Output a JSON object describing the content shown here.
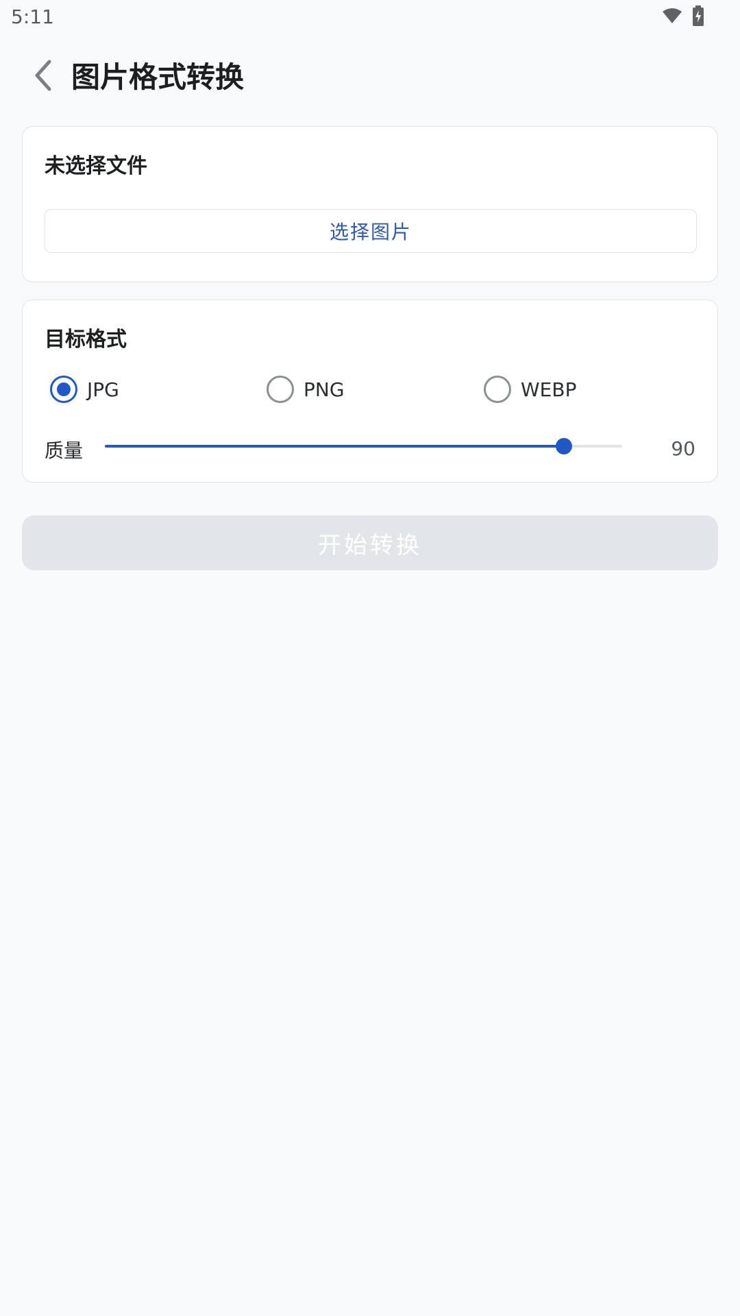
{
  "status_bar": {
    "time": "5:11",
    "icons": [
      "wifi-icon",
      "battery-charging-icon"
    ]
  },
  "header": {
    "back_icon": "chevron-left-icon",
    "title": "图片格式转换"
  },
  "file_card": {
    "status_text": "未选择文件",
    "select_button_label": "选择图片"
  },
  "format_card": {
    "title": "目标格式",
    "options": [
      {
        "label": "JPG",
        "selected": true
      },
      {
        "label": "PNG",
        "selected": false
      },
      {
        "label": "WEBP",
        "selected": false
      }
    ],
    "quality_label": "质量",
    "quality_value": "90",
    "quality_fraction": 0.887
  },
  "start_button_label": "开始转换",
  "colors": {
    "accent": "#2058c8",
    "background": "#f7f9fb",
    "disabled_button": "#e1e6e8"
  }
}
